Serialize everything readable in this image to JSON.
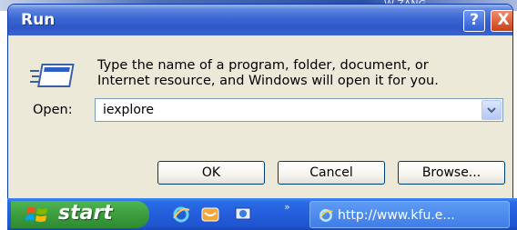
{
  "background": {
    "text": "W ZANG"
  },
  "dialog": {
    "title": "Run",
    "help_label": "?",
    "close_label": "X",
    "prompt_line1": "Type the name of a program, folder, document, or",
    "prompt_line2": "Internet resource, and Windows will open it for you.",
    "open_label": "Open:",
    "open_value": "iexplore",
    "buttons": {
      "ok": "OK",
      "cancel": "Cancel",
      "browse": "Browse..."
    }
  },
  "taskbar": {
    "start_label": "start",
    "chevron": "»",
    "task_label": "http://www.kfu.e..."
  },
  "icons": [
    "run-program-icon",
    "dropdown-arrow-icon",
    "windows-flag-icon",
    "internet-explorer-icon",
    "outlook-express-icon",
    "show-desktop-icon"
  ]
}
